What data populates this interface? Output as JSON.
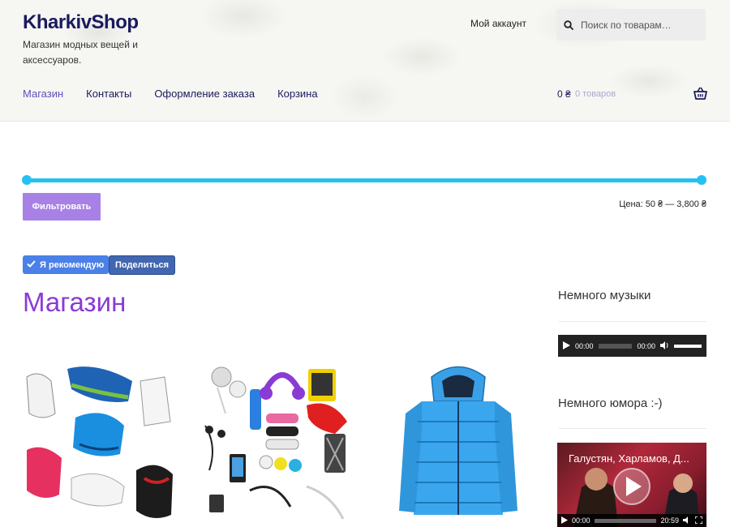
{
  "header": {
    "site_title": "KharkivShop",
    "site_description": "Магазин модных вещей и аксессуаров.",
    "account_link": "Мой аккаунт",
    "search_placeholder": "Поиск по товарам…"
  },
  "nav": {
    "items": [
      {
        "label": "Магазин",
        "active": true
      },
      {
        "label": "Контакты"
      },
      {
        "label": "Оформление заказа"
      },
      {
        "label": "Корзина"
      }
    ]
  },
  "cart": {
    "total": "0 ₴",
    "count": "0 товаров"
  },
  "filter": {
    "button_label": "Фильтровать",
    "price_range": "Цена: 50 ₴ — 3,800 ₴",
    "slider_min_fraction": 0,
    "slider_max_fraction": 1
  },
  "social": {
    "like_label": "Я рекомендую",
    "share_label": "Поделиться"
  },
  "main": {
    "heading": "Магазин",
    "products": [
      {
        "image": "sneakers-collage"
      },
      {
        "image": "gadgets-collage"
      },
      {
        "image": "blue-jacket"
      }
    ]
  },
  "sidebar": {
    "music_title": "Немного музыки",
    "audio_time_current": "00:00",
    "audio_time_total": "00:00",
    "humor_title": "Немного юмора :-)",
    "video_title": "Галустян, Харламов, Д...",
    "video_time_current": "00:00",
    "video_time_total": "20:59"
  },
  "colors": {
    "brand": "#1a1a5e",
    "accent": "#a881e6",
    "slider": "#25c1f2",
    "heading": "#8a3bd4"
  }
}
